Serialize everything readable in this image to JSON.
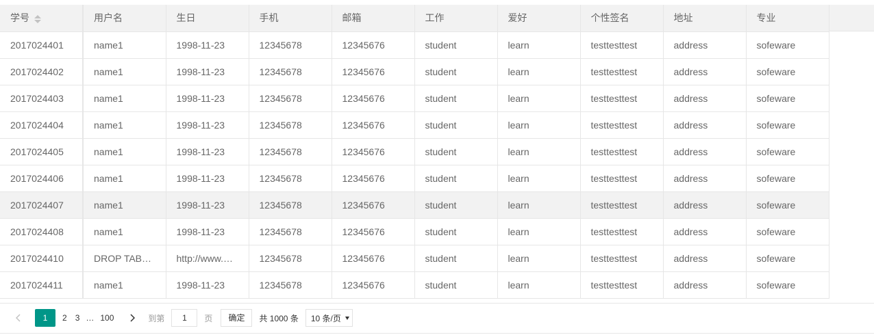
{
  "table": {
    "columns": [
      "学号",
      "用户名",
      "生日",
      "手机",
      "邮箱",
      "工作",
      "爱好",
      "个性签名",
      "地址",
      "专业"
    ],
    "rows": [
      [
        "2017024401",
        "name1",
        "1998-11-23",
        "12345678",
        "12345676",
        "student",
        "learn",
        "testtesttest",
        "address",
        "sofeware"
      ],
      [
        "2017024402",
        "name1",
        "1998-11-23",
        "12345678",
        "12345676",
        "student",
        "learn",
        "testtesttest",
        "address",
        "sofeware"
      ],
      [
        "2017024403",
        "name1",
        "1998-11-23",
        "12345678",
        "12345676",
        "student",
        "learn",
        "testtesttest",
        "address",
        "sofeware"
      ],
      [
        "2017024404",
        "name1",
        "1998-11-23",
        "12345678",
        "12345676",
        "student",
        "learn",
        "testtesttest",
        "address",
        "sofeware"
      ],
      [
        "2017024405",
        "name1",
        "1998-11-23",
        "12345678",
        "12345676",
        "student",
        "learn",
        "testtesttest",
        "address",
        "sofeware"
      ],
      [
        "2017024406",
        "name1",
        "1998-11-23",
        "12345678",
        "12345676",
        "student",
        "learn",
        "testtesttest",
        "address",
        "sofeware"
      ],
      [
        "2017024407",
        "name1",
        "1998-11-23",
        "12345678",
        "12345676",
        "student",
        "learn",
        "testtesttest",
        "address",
        "sofeware"
      ],
      [
        "2017024408",
        "name1",
        "1998-11-23",
        "12345678",
        "12345676",
        "student",
        "learn",
        "testtesttest",
        "address",
        "sofeware"
      ],
      [
        "2017024410",
        "DROP TAB…",
        "http://www.…",
        "12345678",
        "12345676",
        "student",
        "learn",
        "testtesttest",
        "address",
        "sofeware"
      ],
      [
        "2017024411",
        "name1",
        "1998-11-23",
        "12345678",
        "12345676",
        "student",
        "learn",
        "testtesttest",
        "address",
        "sofeware"
      ]
    ],
    "highlighted_row": 6,
    "sort_icon": "sort-icon"
  },
  "pager": {
    "prev_icon": "chevron-left-icon",
    "next_icon": "chevron-right-icon",
    "current_page": "1",
    "pages": [
      "2",
      "3"
    ],
    "ellipsis": "…",
    "last_page": "100",
    "goto_label": "到第",
    "goto_value": "1",
    "page_unit": "页",
    "confirm_label": "确定",
    "total_text": "共 1000 条",
    "page_size": "10 条/页",
    "accent_color": "#009688"
  }
}
